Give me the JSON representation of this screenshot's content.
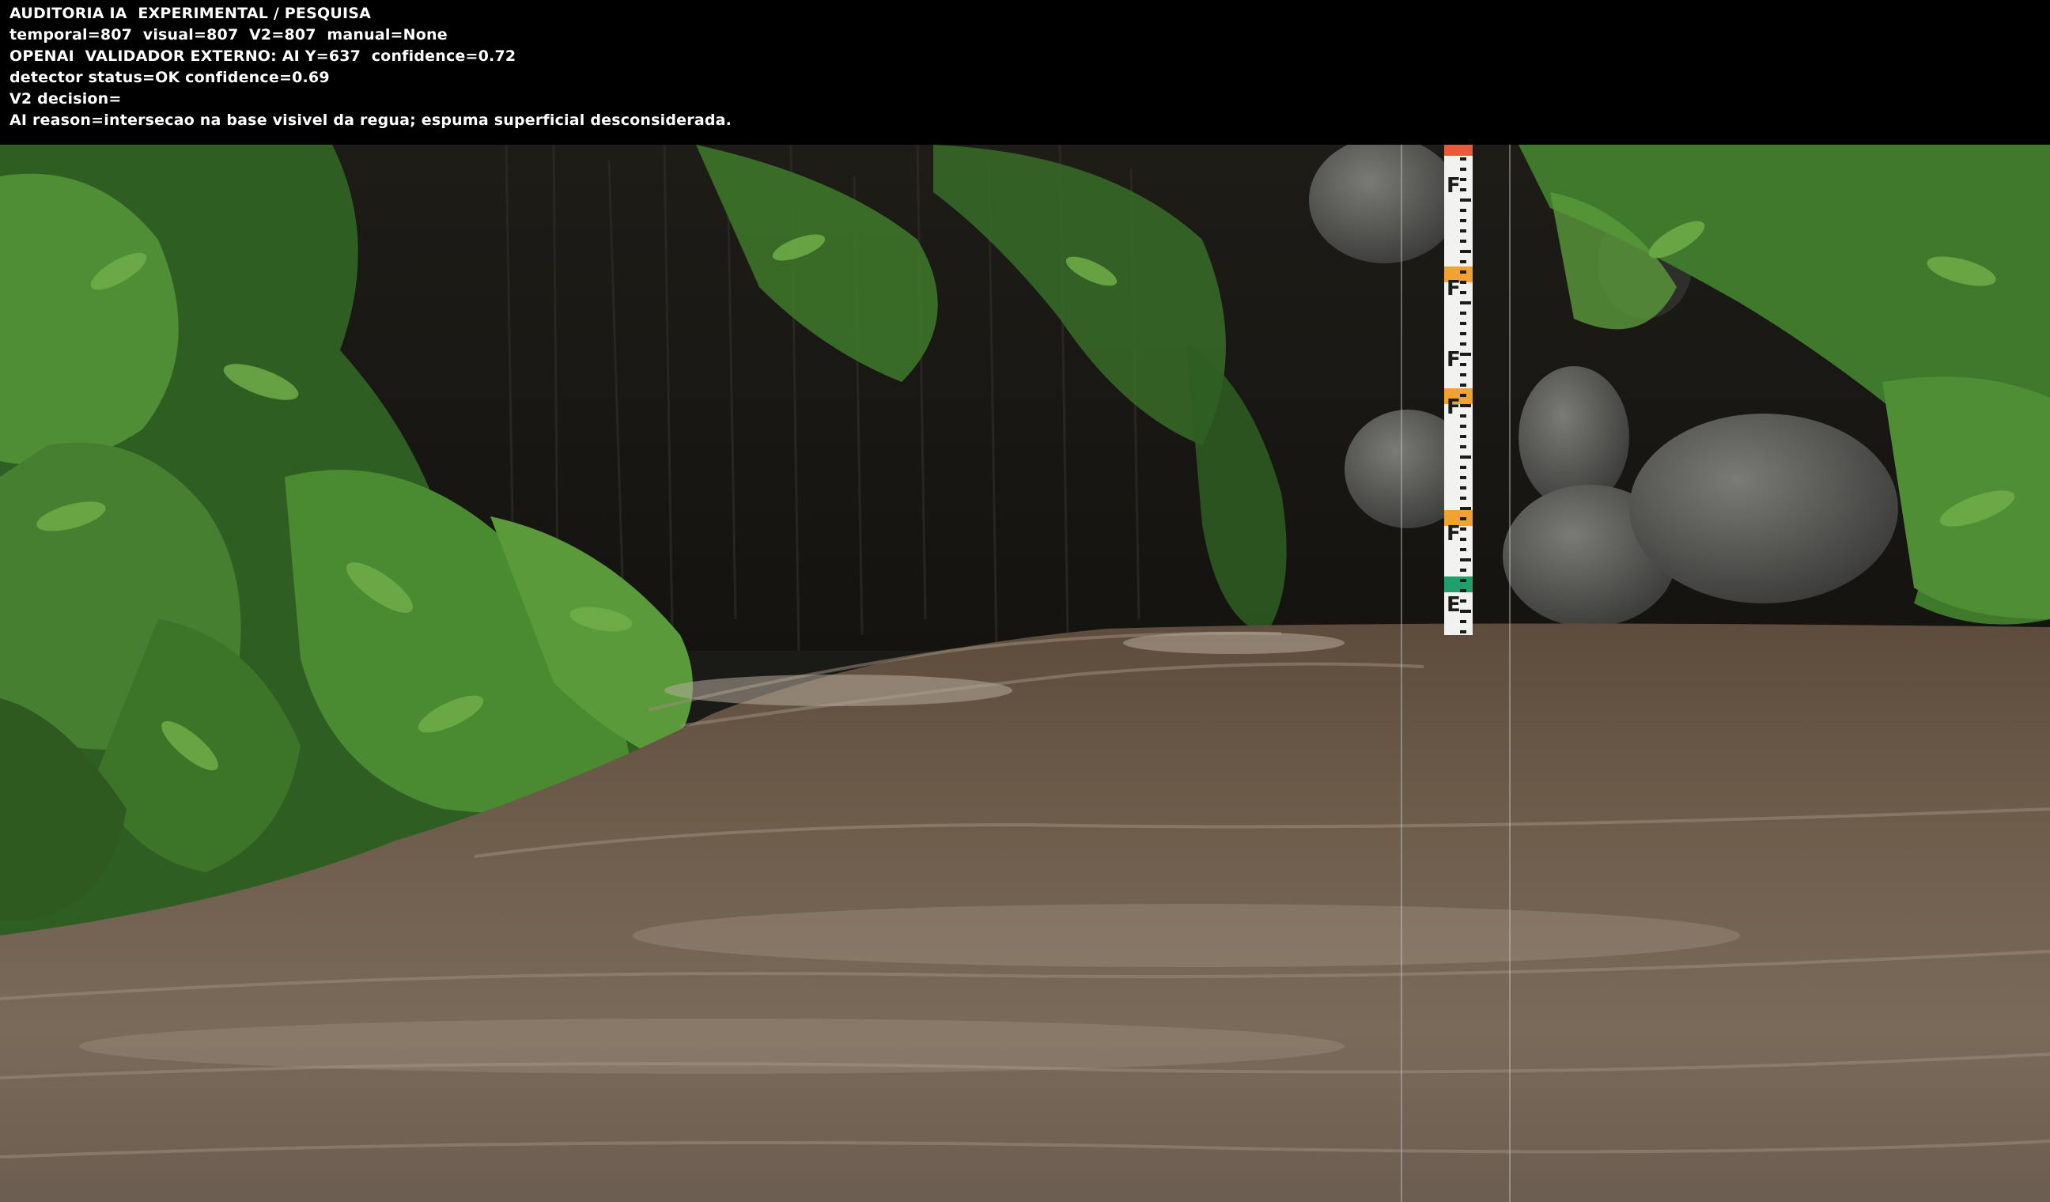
{
  "overlay": {
    "lines": [
      "AUDITORIA IA  EXPERIMENTAL / PESQUISA",
      "temporal=807  visual=807  V2=807  manual=None",
      "OPENAI  VALIDADOR EXTERNO: AI Y=637  confidence=0.72",
      "detector status=OK confidence=0.69",
      "V2 decision=",
      "AI reason=intersecao na base visivel da regua; espuma superficial desconsiderada."
    ]
  },
  "gauge": {
    "labels": [
      "F",
      "F",
      "F",
      "F",
      "F",
      "E"
    ],
    "colors": {
      "red": "#e85a3a",
      "orange": "#f2a233",
      "green": "#1fa06a",
      "white": "#f2f2f0",
      "black": "#1c1c1c"
    }
  },
  "colors": {
    "water": "#6b5a48",
    "vegetation": "#3f7a2c",
    "rock": "#5a5a58",
    "background_dark": "#1a1a17"
  }
}
